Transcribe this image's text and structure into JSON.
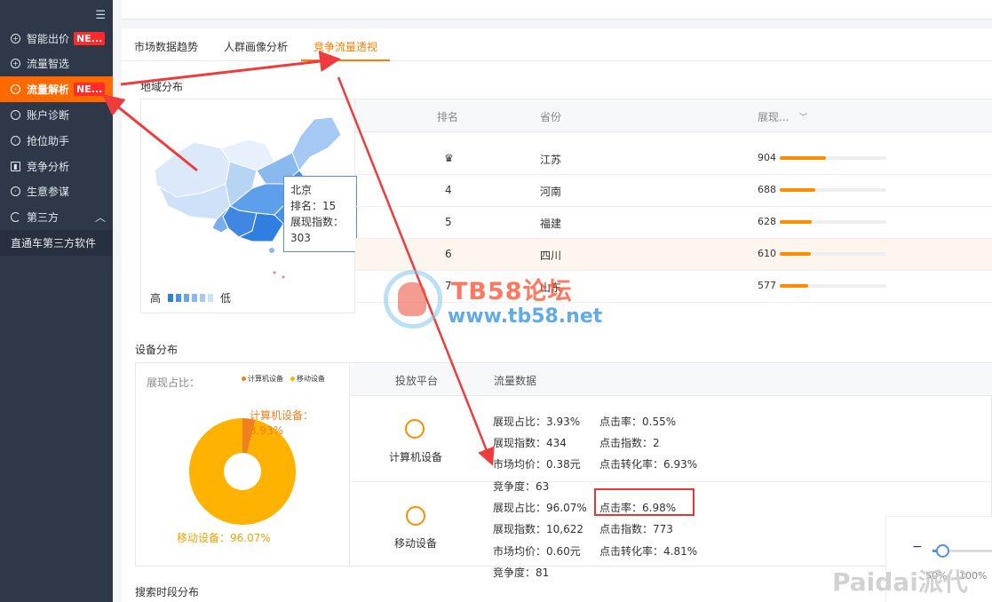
{
  "sidebar": {
    "items": [
      {
        "label": "智能出价",
        "badge": "NE..."
      },
      {
        "label": "流量智选",
        "badge": ""
      },
      {
        "label": "流量解析",
        "badge": "NE..."
      },
      {
        "label": "账户诊断",
        "badge": ""
      },
      {
        "label": "抢位助手",
        "badge": ""
      },
      {
        "label": "竞争分析",
        "badge": ""
      },
      {
        "label": "生意参谋",
        "badge": ""
      },
      {
        "label": "第三方",
        "badge": ""
      }
    ],
    "sub_item": "直通车第三方软件"
  },
  "tabs": [
    "市场数据趋势",
    "人群画像分析",
    "竞争流量透视"
  ],
  "region": {
    "title": "地域分布",
    "tooltip": {
      "name": "北京",
      "rank": "排名：15",
      "index_label": "展现指数：",
      "index_value": "303"
    },
    "legend_high": "高",
    "legend_low": "低",
    "headers": {
      "rank": "排名",
      "province": "省份",
      "index": "展现..."
    },
    "rows": [
      {
        "rank": "",
        "province": "江苏",
        "value": "904",
        "fill": 0.43
      },
      {
        "rank": "4",
        "province": "河南",
        "value": "688",
        "fill": 0.33
      },
      {
        "rank": "5",
        "province": "福建",
        "value": "628",
        "fill": 0.3
      },
      {
        "rank": "6",
        "province": "四川",
        "value": "610",
        "fill": 0.29
      },
      {
        "rank": "7",
        "province": "山东",
        "value": "577",
        "fill": 0.27
      }
    ]
  },
  "device": {
    "title": "设备分布",
    "share_label": "展现占比：",
    "legend": [
      "计算机设备",
      "移动设备"
    ],
    "pie_pc_label": "计算机设备：3.93%",
    "pie_mobile_label": "移动设备：96.07%",
    "headers": {
      "platform": "投放平台",
      "data": "流量数据"
    },
    "pc": {
      "label": "计算机设备",
      "left": [
        "展现占比：3.93%",
        "展现指数：434",
        "市场均价：0.38元",
        "竞争度：63"
      ],
      "right": [
        "点击率：0.55%",
        "点击指数：2",
        "点击转化率：6.93%"
      ]
    },
    "mobile": {
      "label": "移动设备",
      "left": [
        "展现占比：96.07%",
        "展现指数：10,622",
        "市场均价：0.60元",
        "竞争度：81"
      ],
      "right": [
        "点击率：6.98%",
        "点击指数：773",
        "点击转化率：4.81%"
      ]
    },
    "pie_share": [
      3.93,
      96.07
    ]
  },
  "search_time_title": "搜索时段分布",
  "zoom": {
    "minus": "−",
    "low": "50%",
    "high": "100%"
  },
  "watermarks": {
    "tb58_title": "TB58论坛",
    "tb58_url": "www.tb58.net",
    "paidai": "Paidai派代"
  },
  "colors": {
    "accent": "#ff7e00",
    "sidebar": "#2f3848",
    "pie_mobile": "#ffb300",
    "pie_pc": "#f07f1e",
    "map_blue": "#2f7fe0"
  }
}
